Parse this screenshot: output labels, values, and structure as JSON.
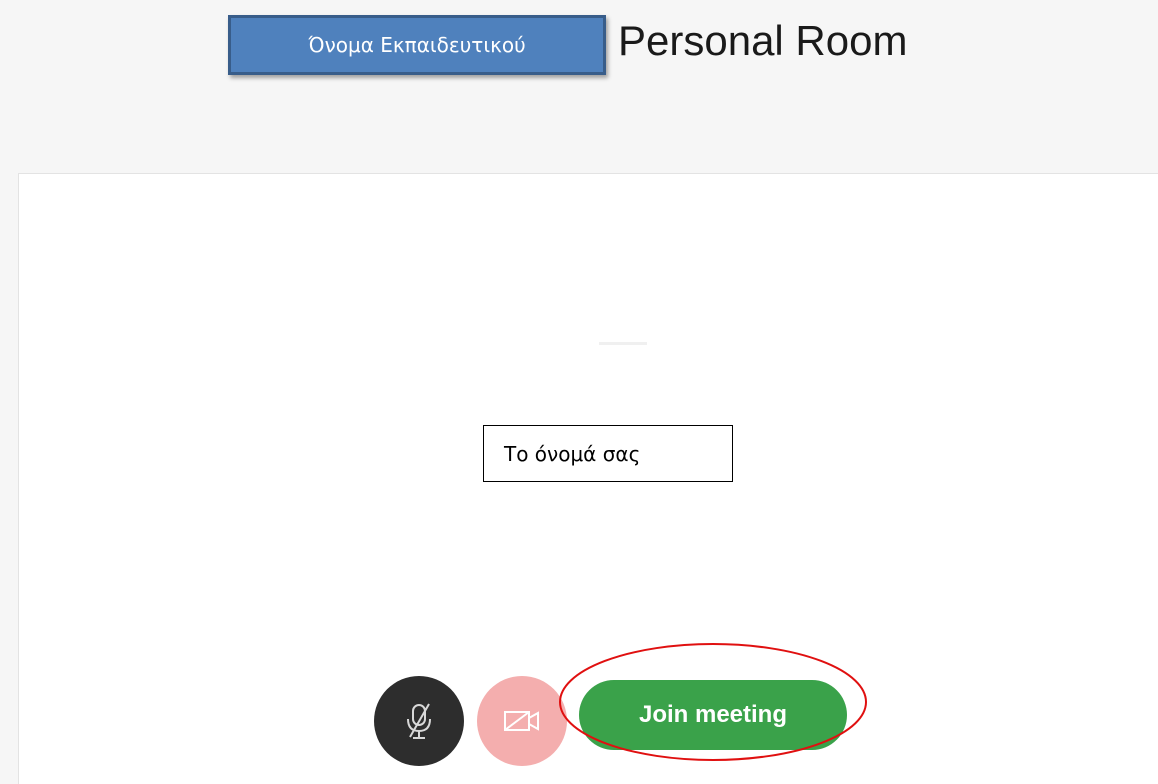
{
  "header": {
    "teacher_name_label": "Όνομα Εκπαιδευτικού",
    "room_title": "Personal Room"
  },
  "prejoin": {
    "name_field_value": "Το όνομά σας"
  },
  "controls": {
    "mic_icon": "microphone-muted-icon",
    "camera_icon": "camera-off-icon",
    "join_label": "Join meeting"
  },
  "colors": {
    "join_green": "#3aa24a",
    "mic_dark": "#2d2d2d",
    "camera_off_pink": "#f4aeae",
    "annotation_red": "#e01010",
    "callout_blue": "#4f81bd"
  }
}
